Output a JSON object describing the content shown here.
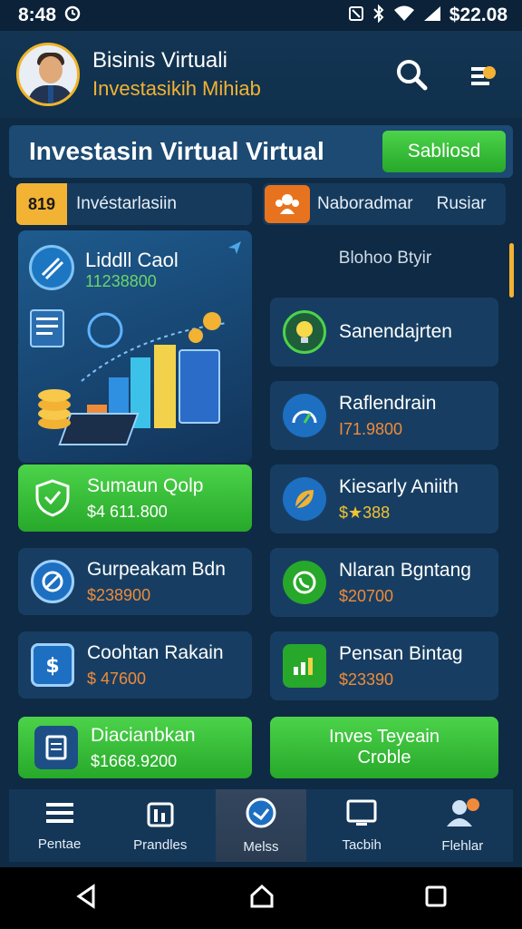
{
  "status": {
    "time": "8:48",
    "right_text": "$22.08"
  },
  "header": {
    "title": "Bisinis Virtuali",
    "subtitle": "Investasikih Mihiab"
  },
  "banner": {
    "title": "Investasin  Virtual Virtual",
    "button": "Sabliosd"
  },
  "tabs": {
    "left_badge": "819",
    "left_label": "Invéstarlasiin",
    "right_label1": "Naboradmar",
    "right_label2": "Rusiar"
  },
  "feature": {
    "title": "Liddll Caol",
    "value": "11238800"
  },
  "right_header": "Blohoo Btyir",
  "cards": [
    {
      "title": "Sanendajrten",
      "value": ""
    },
    {
      "title": "Raflendrain",
      "value": "I71.9800"
    },
    {
      "title": "Sumaun Qolp",
      "value": "$4 611.800"
    },
    {
      "title": "Kiesarly Aniith",
      "value": "$★388"
    },
    {
      "title": "Gurpeakam Bdn",
      "value": "$238900"
    },
    {
      "title": "Nlaran Bgntang",
      "value": "$20700"
    },
    {
      "title": "Coohtan  Rakain",
      "value": "$ 47600"
    },
    {
      "title": "Pensan Bintag",
      "value": "$23390"
    },
    {
      "title": "Diacianbkan",
      "value": "$1668.9200"
    },
    {
      "title": "Inves Teyeain",
      "value": "Croble"
    }
  ],
  "bottom_nav": [
    {
      "label": "Pentae"
    },
    {
      "label": "Prandles"
    },
    {
      "label": "Melss"
    },
    {
      "label": "Tacbih"
    },
    {
      "label": "Flehlar"
    }
  ],
  "colors": {
    "accent_green": "#3cc23c",
    "accent_orange": "#f08b3a",
    "accent_yellow": "#f2b233",
    "background": "#0f2a44"
  }
}
